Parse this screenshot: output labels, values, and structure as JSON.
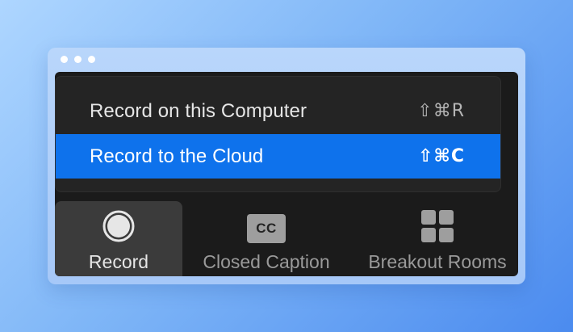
{
  "menu": {
    "items": [
      {
        "label": "Record on this Computer",
        "shortcut": "⇧⌘R",
        "selected": false
      },
      {
        "label": "Record to the Cloud",
        "shortcut": "⇧⌘C",
        "selected": true
      }
    ]
  },
  "toolbar": {
    "record": {
      "label": "Record",
      "icon": "record-icon"
    },
    "closed_caption": {
      "label": "Closed Caption",
      "icon": "cc-icon",
      "icon_text": "CC"
    },
    "breakout": {
      "label": "Breakout Rooms",
      "icon": "breakout-rooms-icon"
    }
  },
  "colors": {
    "accent": "#0e72ec",
    "app_background": "#1b1b1b",
    "menu_background": "#242424"
  }
}
